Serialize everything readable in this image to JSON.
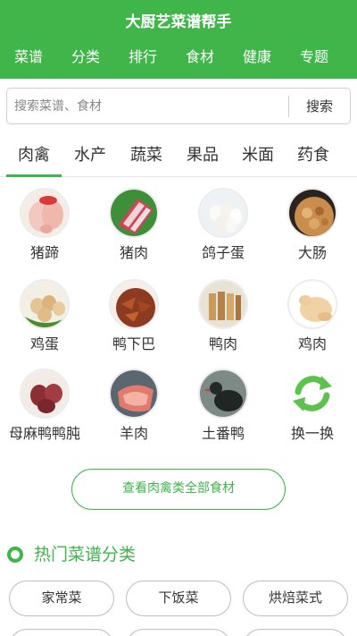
{
  "app": {
    "title": "大厨艺菜谱帮手"
  },
  "nav": [
    "菜谱",
    "分类",
    "排行",
    "食材",
    "健康",
    "专题"
  ],
  "search": {
    "placeholder": "搜索菜谱、食材",
    "button": "搜索"
  },
  "tabs": [
    "肉禽",
    "水产",
    "蔬菜",
    "果品",
    "米面",
    "药食"
  ],
  "active_tab": "肉禽",
  "ingredients": [
    {
      "label": "猪蹄",
      "icon": "pig-trotter-photo"
    },
    {
      "label": "猪肉",
      "icon": "pork-photo"
    },
    {
      "label": "鸽子蛋",
      "icon": "pigeon-egg-photo"
    },
    {
      "label": "大肠",
      "icon": "intestine-photo"
    },
    {
      "label": "鸡蛋",
      "icon": "egg-photo"
    },
    {
      "label": "鸭下巴",
      "icon": "duck-chin-photo"
    },
    {
      "label": "鸭肉",
      "icon": "duck-meat-photo"
    },
    {
      "label": "鸡肉",
      "icon": "chicken-photo"
    },
    {
      "label": "母麻鸭鸭肫",
      "icon": "duck-gizzard-photo"
    },
    {
      "label": "羊肉",
      "icon": "mutton-photo"
    },
    {
      "label": "土番鸭",
      "icon": "muscovy-duck-photo"
    },
    {
      "label": "换一换",
      "icon": "refresh-icon"
    }
  ],
  "view_all": "查看肉禽类全部食材",
  "hot_section": {
    "title": "热门菜谱分类",
    "items": [
      "家常菜",
      "下饭菜",
      "烘焙菜式"
    ]
  },
  "colors": {
    "brand": "#3fb54a",
    "text": "#333333",
    "border": "#bdbdbd"
  }
}
